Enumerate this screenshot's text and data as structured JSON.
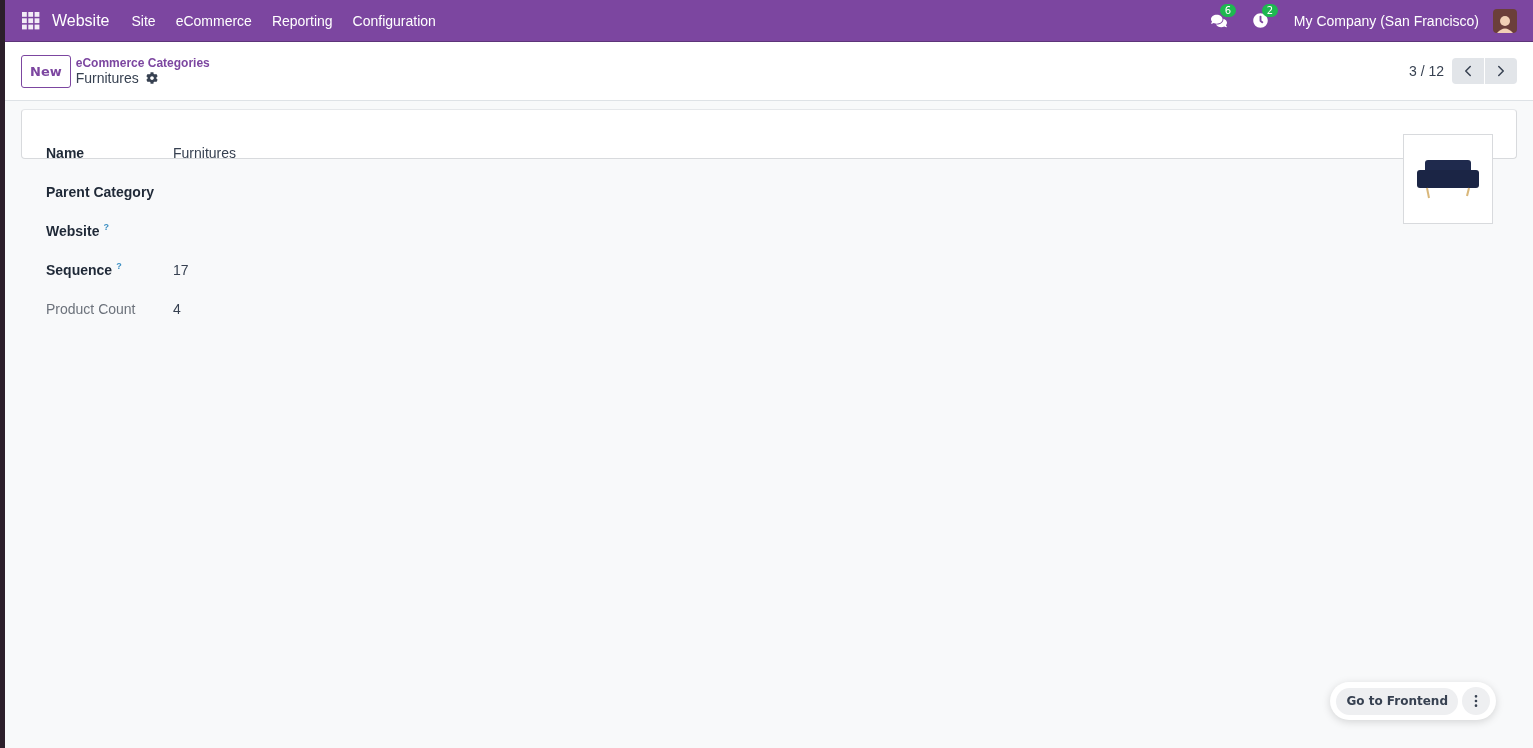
{
  "navbar": {
    "app": "Website",
    "menus": [
      "Site",
      "eCommerce",
      "Reporting",
      "Configuration"
    ],
    "messages_count": "6",
    "activities_count": "2",
    "company": "My Company (San Francisco)"
  },
  "control_panel": {
    "new_button": "New",
    "breadcrumb": "eCommerce Categories",
    "record": "Furnitures",
    "pager": "3 / 12"
  },
  "fields": [
    {
      "label": "Name",
      "value": "Furnitures",
      "kind": "editable"
    },
    {
      "label": "Parent Category",
      "kind": "editable"
    },
    {
      "label": "Website",
      "help_mark": "?",
      "kind": "editable"
    },
    {
      "label": "Sequence",
      "value": "17",
      "help_mark": "?",
      "kind": "editable"
    },
    {
      "label": "Product Count",
      "value": "4",
      "kind": "readonly"
    }
  ],
  "frontend_button": "Go to Frontend"
}
